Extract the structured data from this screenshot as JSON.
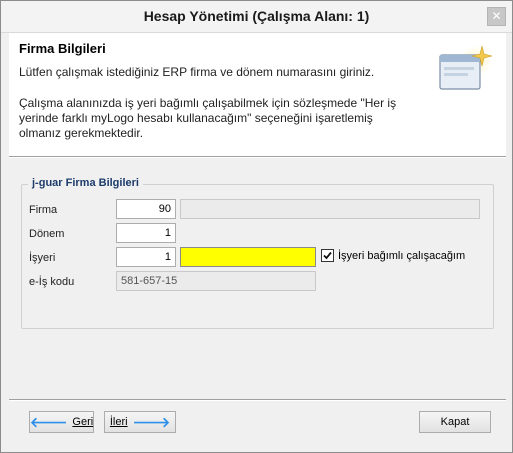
{
  "window": {
    "title": "Hesap Yönetimi (Çalışma Alanı: 1)"
  },
  "header": {
    "title": "Firma Bilgileri",
    "line1": "Lütfen çalışmak istediğiniz ERP firma ve dönem numarasını giriniz.",
    "line2": "Çalışma alanınızda iş yeri bağımlı çalışabilmek için sözleşmede \"Her iş",
    "line3": "yerinde farklı myLogo hesabı kullanacağım\" seçeneğini işaretlemiş",
    "line4": "olmanız gerekmektedir."
  },
  "group": {
    "legend": "j-guar Firma Bilgileri",
    "firma_label": "Firma",
    "firma_value": "90",
    "firma_name": "",
    "donem_label": "Dönem",
    "donem_value": "1",
    "isyeri_label": "İşyeri",
    "isyeri_value": "1",
    "isyeri_name": "",
    "isyeri_checkbox_label": "İşyeri bağımlı çalışacağım",
    "isyeri_checkbox_checked": true,
    "eis_label": "e-İş kodu",
    "eis_value": "581-657-15"
  },
  "buttons": {
    "back": "Geri",
    "next": "İleri",
    "close": "Kapat"
  },
  "colors": {
    "highlight_field": "#ffff00",
    "arrow": "#2e8fe8"
  }
}
